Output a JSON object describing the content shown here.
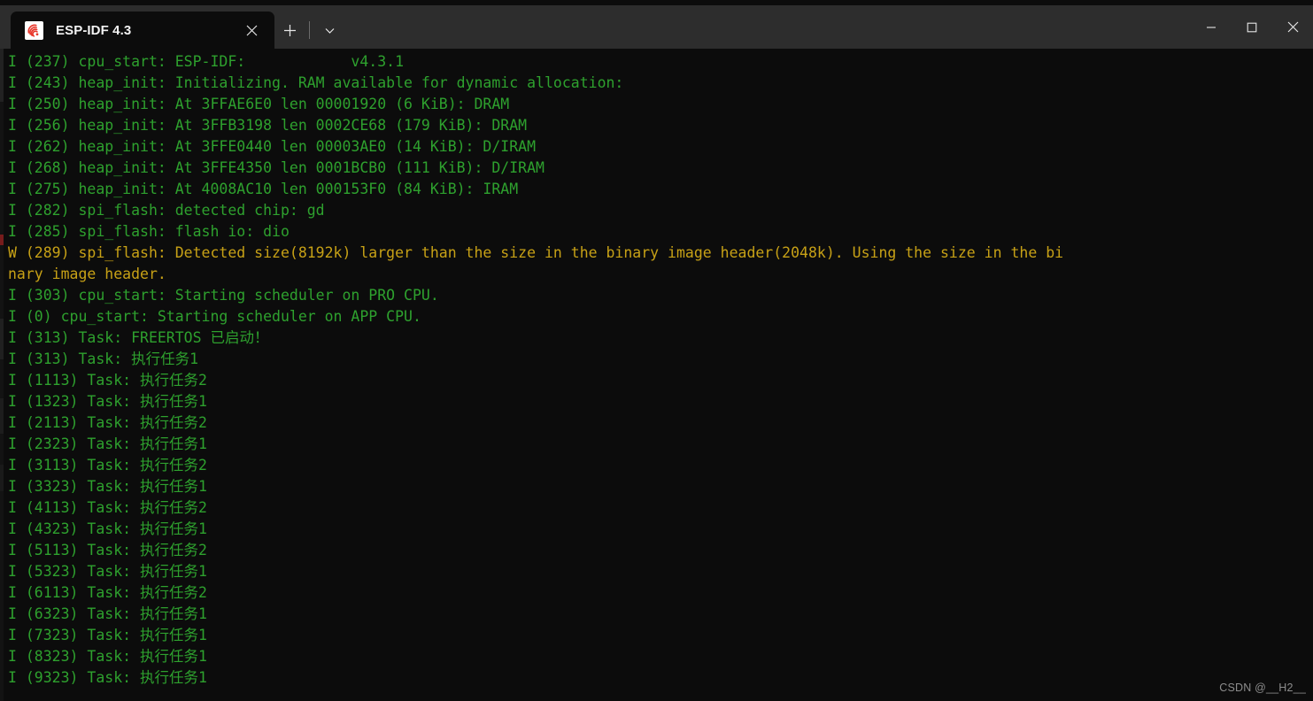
{
  "window": {
    "background": "#0c0c0c",
    "titlebar_background": "#2d2d2d",
    "controls": {
      "minimize_label": "—",
      "maximize_label": "☐",
      "close_label": "✕"
    }
  },
  "tabs": [
    {
      "title": "ESP-IDF 4.3",
      "icon": "espressif-logo-icon",
      "close_label": "✕",
      "active": true
    }
  ],
  "tab_controls": {
    "new_tab_label": "+",
    "dropdown_label": "⌄"
  },
  "terminal": {
    "font_size_px": 16.5,
    "line_height_px": 24,
    "colors": {
      "info": "#2ea12e",
      "warning": "#c7a116",
      "background": "#0c0c0c"
    },
    "lines": [
      {
        "level": "info",
        "text": "I (237) cpu_start: ESP-IDF:            v4.3.1"
      },
      {
        "level": "info",
        "text": "I (243) heap_init: Initializing. RAM available for dynamic allocation:"
      },
      {
        "level": "info",
        "text": "I (250) heap_init: At 3FFAE6E0 len 00001920 (6 KiB): DRAM"
      },
      {
        "level": "info",
        "text": "I (256) heap_init: At 3FFB3198 len 0002CE68 (179 KiB): DRAM"
      },
      {
        "level": "info",
        "text": "I (262) heap_init: At 3FFE0440 len 00003AE0 (14 KiB): D/IRAM"
      },
      {
        "level": "info",
        "text": "I (268) heap_init: At 3FFE4350 len 0001BCB0 (111 KiB): D/IRAM"
      },
      {
        "level": "info",
        "text": "I (275) heap_init: At 4008AC10 len 000153F0 (84 KiB): IRAM"
      },
      {
        "level": "info",
        "text": "I (282) spi_flash: detected chip: gd"
      },
      {
        "level": "info",
        "text": "I (285) spi_flash: flash io: dio"
      },
      {
        "level": "warn",
        "text": "W (289) spi_flash: Detected size(8192k) larger than the size in the binary image header(2048k). Using the size in the bi"
      },
      {
        "level": "warn",
        "text": "nary image header."
      },
      {
        "level": "info",
        "text": "I (303) cpu_start: Starting scheduler on PRO CPU."
      },
      {
        "level": "info",
        "text": "I (0) cpu_start: Starting scheduler on APP CPU."
      },
      {
        "level": "info",
        "text": "I (313) Task: FREERTOS 已启动！"
      },
      {
        "level": "info",
        "text": "I (313) Task: 执行任务1"
      },
      {
        "level": "info",
        "text": "I (1113) Task: 执行任务2"
      },
      {
        "level": "info",
        "text": "I (1323) Task: 执行任务1"
      },
      {
        "level": "info",
        "text": "I (2113) Task: 执行任务2"
      },
      {
        "level": "info",
        "text": "I (2323) Task: 执行任务1"
      },
      {
        "level": "info",
        "text": "I (3113) Task: 执行任务2"
      },
      {
        "level": "info",
        "text": "I (3323) Task: 执行任务1"
      },
      {
        "level": "info",
        "text": "I (4113) Task: 执行任务2"
      },
      {
        "level": "info",
        "text": "I (4323) Task: 执行任务1"
      },
      {
        "level": "info",
        "text": "I (5113) Task: 执行任务2"
      },
      {
        "level": "info",
        "text": "I (5323) Task: 执行任务1"
      },
      {
        "level": "info",
        "text": "I (6113) Task: 执行任务2"
      },
      {
        "level": "info",
        "text": "I (6323) Task: 执行任务1"
      },
      {
        "level": "info",
        "text": "I (7323) Task: 执行任务1"
      },
      {
        "level": "info",
        "text": "I (8323) Task: 执行任务1"
      },
      {
        "level": "info",
        "text": "I (9323) Task: 执行任务1"
      }
    ]
  },
  "watermark": {
    "text": "CSDN @__H2__"
  }
}
